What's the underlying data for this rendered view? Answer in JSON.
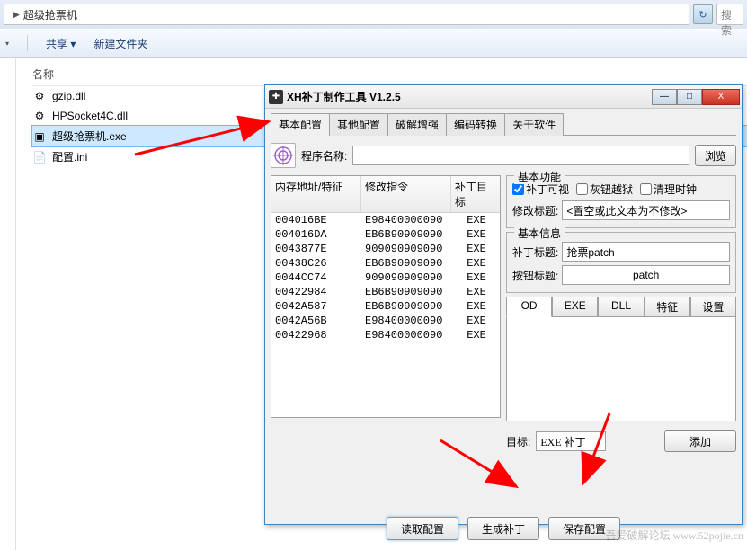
{
  "explorer": {
    "path_segment": "超级抢票机",
    "refresh_glyph": "↻",
    "search_placeholder": "搜索",
    "toolbar": {
      "share": "共享 ▾",
      "newfolder": "新建文件夹"
    },
    "col_name": "名称",
    "files": [
      {
        "icon": "⚙",
        "name": "gzip.dll"
      },
      {
        "icon": "⚙",
        "name": "HPSocket4C.dll"
      },
      {
        "icon": "▣",
        "name": "超级抢票机.exe",
        "selected": true
      },
      {
        "icon": "📄",
        "name": "配置.ini"
      }
    ]
  },
  "toolwin": {
    "title": "XH补丁制作工具 V1.2.5",
    "minimize": "—",
    "maximize": "□",
    "close": "X",
    "tabs": [
      "基本配置",
      "其他配置",
      "破解增强",
      "编码转换",
      "关于软件"
    ],
    "prog_label": "程序名称:",
    "prog_value": "",
    "browse": "浏览",
    "table": {
      "headers": [
        "内存地址/特征",
        "修改指令",
        "补丁目标"
      ],
      "rows": [
        [
          "004016BE",
          "E98400000090",
          "EXE"
        ],
        [
          "004016DA",
          "EB6B90909090",
          "EXE"
        ],
        [
          "0043877E",
          "909090909090",
          "EXE"
        ],
        [
          "00438C26",
          "EB6B90909090",
          "EXE"
        ],
        [
          "0044CC74",
          "909090909090",
          "EXE"
        ],
        [
          "00422984",
          "EB6B90909090",
          "EXE"
        ],
        [
          "0042A587",
          "EB6B90909090",
          "EXE"
        ],
        [
          "0042A56B",
          "E98400000090",
          "EXE"
        ],
        [
          "00422968",
          "E98400000090",
          "EXE"
        ]
      ]
    },
    "basic": {
      "legend": "基本功能",
      "chk_visible": "补丁可视",
      "chk_gray": "灰钮越狱",
      "chk_clean": "清理时钟",
      "mod_title_label": "修改标题:",
      "mod_title_value": "<置空或此文本为不修改>"
    },
    "info": {
      "legend": "基本信息",
      "patch_title_label": "补丁标题:",
      "patch_title_value": "抢票patch",
      "btn_title_label": "按钮标题:",
      "btn_title_value": "patch"
    },
    "stabs": [
      "OD",
      "EXE",
      "DLL",
      "特征",
      "设置"
    ],
    "target_label": "目标:",
    "target_value": "EXE 补丁",
    "add_btn": "添加",
    "btm": {
      "read": "读取配置",
      "gen": "生成补丁",
      "save": "保存配置"
    }
  },
  "watermark": "吾爱破解论坛 www.52pojie.cn"
}
